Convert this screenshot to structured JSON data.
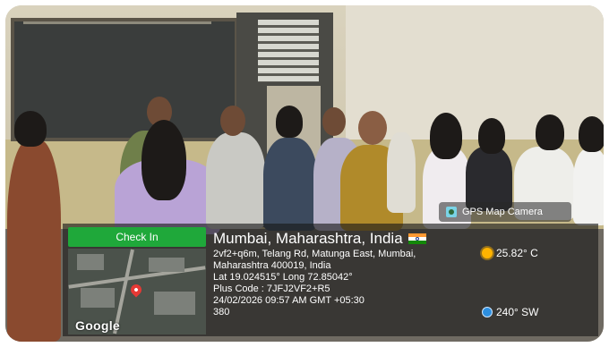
{
  "photo": {
    "description_icon": "classroom-photo"
  },
  "gps_tag": {
    "label": "GPS Map Camera",
    "icon": "gps-map-camera-icon"
  },
  "check_in": {
    "label": "Check In",
    "color": "#1fa83a"
  },
  "map": {
    "brand": "Google",
    "pin_icon": "location-pin-icon"
  },
  "location": {
    "city": "Mumbai, Maharashtra, India",
    "flag_icon": "india-flag-icon",
    "address_line1": "2vf2+q6m, Telang Rd, Matunga East, Mumbai,",
    "address_line2": "Maharashtra 400019, India",
    "coords": "Lat 19.024515° Long 72.85042°",
    "plus_code": "Plus Code : 7JFJ2VF2+R5",
    "datetime": "24/02/2026 09:57 AM GMT +05:30",
    "extra": "380"
  },
  "weather": {
    "temperature": "25.82° C",
    "icon": "sun-icon"
  },
  "wind": {
    "direction": "240° SW",
    "icon": "compass-icon"
  }
}
